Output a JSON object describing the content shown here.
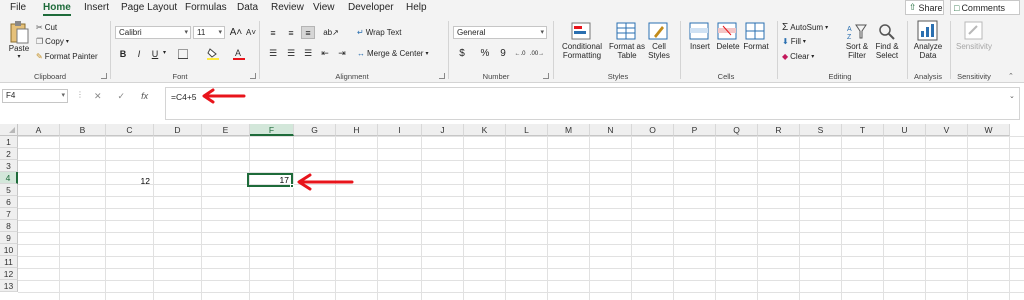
{
  "menu": {
    "tabs": [
      "File",
      "Home",
      "Insert",
      "Page Layout",
      "Formulas",
      "Data",
      "Review",
      "View",
      "Developer",
      "Help"
    ],
    "active_tab": "Home",
    "share_label": "Share",
    "comments_label": "Comments"
  },
  "ribbon": {
    "clipboard": {
      "paste": "Paste",
      "cut": "Cut",
      "copy": "Copy",
      "format_painter": "Format Painter",
      "label": "Clipboard"
    },
    "font": {
      "font_name": "Calibri",
      "font_size": "11",
      "bold": "B",
      "italic": "I",
      "underline": "U",
      "label": "Font"
    },
    "alignment": {
      "wrap_text": "Wrap Text",
      "merge_center": "Merge & Center",
      "label": "Alignment"
    },
    "number": {
      "format": "General",
      "currency": "$",
      "percent": "%",
      "comma": "9",
      "label": "Number"
    },
    "styles": {
      "conditional_formatting_1": "Conditional",
      "conditional_formatting_2": "Formatting",
      "format_as_table_1": "Format as",
      "format_as_table_2": "Table",
      "cell_styles_1": "Cell",
      "cell_styles_2": "Styles",
      "label": "Styles"
    },
    "cells": {
      "insert": "Insert",
      "delete": "Delete",
      "format": "Format",
      "label": "Cells"
    },
    "editing": {
      "autosum": "AutoSum",
      "fill": "Fill",
      "clear": "Clear",
      "sort_filter_1": "Sort &",
      "sort_filter_2": "Filter",
      "find_select_1": "Find &",
      "find_select_2": "Select",
      "label": "Editing"
    },
    "analysis": {
      "analyze_data_1": "Analyze",
      "analyze_data_2": "Data",
      "label": "Analysis"
    },
    "sensitivity": {
      "button": "Sensitivity",
      "label": "Sensitivity"
    }
  },
  "formula_bar": {
    "name_box": "F4",
    "fx": "fx",
    "formula": "=C4+5"
  },
  "grid": {
    "columns": [
      "A",
      "B",
      "C",
      "D",
      "E",
      "F",
      "G",
      "H",
      "I",
      "J",
      "K",
      "L",
      "M",
      "N",
      "O",
      "P",
      "Q",
      "R",
      "S",
      "T",
      "U",
      "V",
      "W"
    ],
    "rows": [
      "1",
      "2",
      "3",
      "4",
      "5",
      "6",
      "7",
      "8",
      "9",
      "10",
      "11",
      "12",
      "13"
    ],
    "selected_column": "F",
    "selected_row": "4",
    "cells": {
      "C4": "12",
      "F4": "17"
    }
  },
  "colors": {
    "accent": "#1e6b3a",
    "annotation_arrow": "#e8141b"
  }
}
